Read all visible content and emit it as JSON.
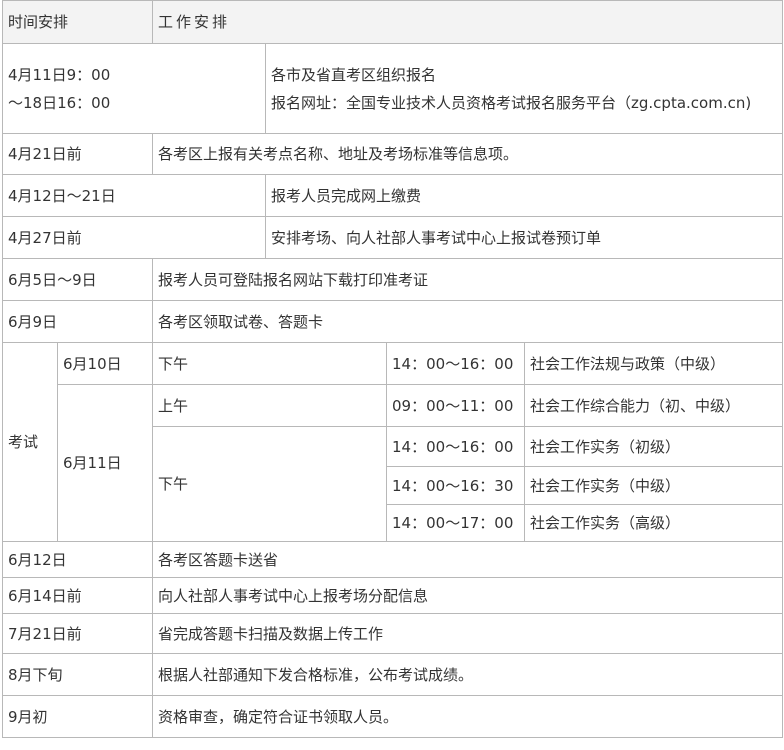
{
  "header": {
    "time_label": "时间安排",
    "work_label": "工作安排"
  },
  "rows": {
    "r1": {
      "time_line1": "4月11日9：00",
      "time_line2": "～18日16：00",
      "work_line1": "各市及省直考区组织报名",
      "work_line2": "报名网址：全国专业技术人员资格考试报名服务平台（zg.cpta.com.cn)"
    },
    "r2": {
      "time": "4月21日前",
      "work": "各考区上报有关考点名称、地址及考场标准等信息项。"
    },
    "r3": {
      "time": "4月12日～21日",
      "work": "报考人员完成网上缴费"
    },
    "r4": {
      "time": "4月27日前",
      "work": "安排考场、向人社部人事考试中心上报试卷预订单"
    },
    "r5": {
      "time": "6月5日～9日",
      "work": "报考人员可登陆报名网站下载打印准考证"
    },
    "r6": {
      "time": "6月9日",
      "work": "各考区领取试卷、答题卡"
    }
  },
  "exam": {
    "label": "考试",
    "day1": {
      "date": "6月10日",
      "period": "下午",
      "time": "14：00～16：00",
      "subject": "社会工作法规与政策（中级）"
    },
    "day2": {
      "date": "6月11日",
      "morning": {
        "period": "上午",
        "time": "09：00～11：00",
        "subject": "社会工作综合能力（初、中级）"
      },
      "afternoon": {
        "period": "下午",
        "s1": {
          "time": "14：00～16：00",
          "subject": "社会工作实务（初级）"
        },
        "s2": {
          "time": "14：00～16：30",
          "subject": "社会工作实务（中级）"
        },
        "s3": {
          "time": "14：00～17：00",
          "subject": "社会工作实务（高级）"
        }
      }
    }
  },
  "rows_after": {
    "r7": {
      "time": "6月12日",
      "work": "各考区答题卡送省"
    },
    "r8": {
      "time": "6月14日前",
      "work": "向人社部人事考试中心上报考场分配信息"
    },
    "r9": {
      "time": "7月21日前",
      "work": "省完成答题卡扫描及数据上传工作"
    },
    "r10": {
      "time": "8月下旬",
      "work": "根据人社部通知下发合格标准，公布考试成绩。"
    },
    "r11": {
      "time": "9月初",
      "work": "资格审查，确定符合证书领取人员。"
    }
  }
}
